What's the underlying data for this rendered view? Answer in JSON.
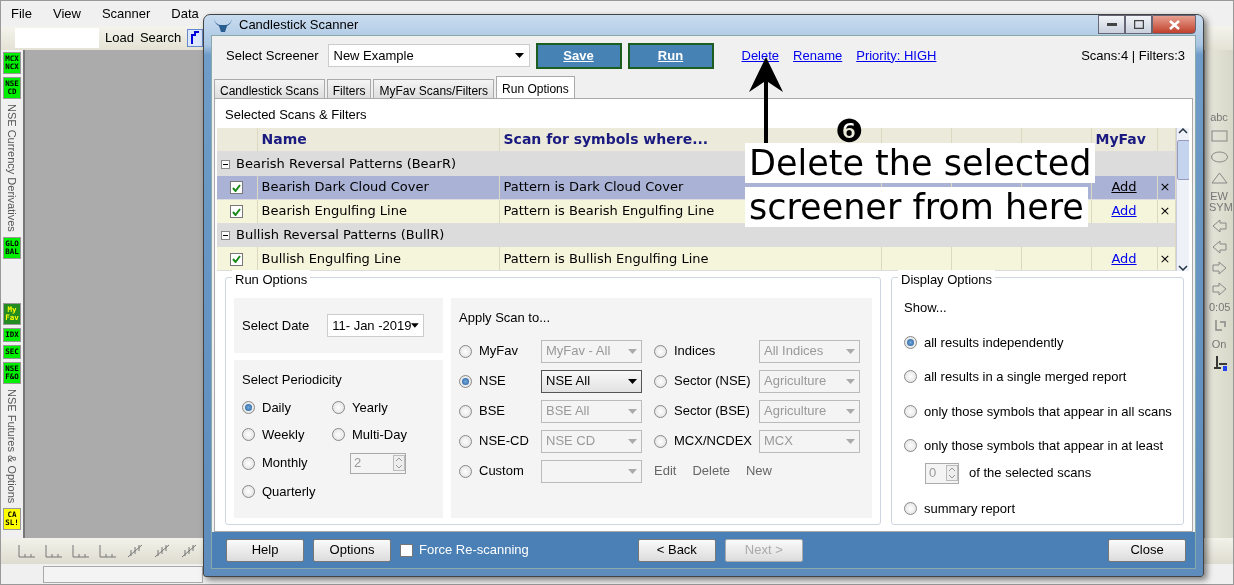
{
  "menu": [
    {
      "label": "File"
    },
    {
      "label": "View"
    },
    {
      "label": "Scanner"
    },
    {
      "label": "Data"
    }
  ],
  "toolbar": {
    "load": "Load",
    "search": "Search"
  },
  "left_strip": [
    {
      "kind": "badge",
      "lines": [
        "MCX",
        "NCX"
      ],
      "color": "#00ee00"
    },
    {
      "kind": "badge",
      "lines": [
        "NSE",
        "CD"
      ],
      "color": "#00ee00"
    },
    {
      "kind": "caption",
      "label": "NSE Currency Derivatives"
    },
    {
      "kind": "badge",
      "lines": [
        "GLO",
        "BAL"
      ],
      "color": "#00ee00"
    },
    {
      "kind": "gap"
    },
    {
      "kind": "badge",
      "lines": [
        "My",
        "Fav"
      ],
      "color": "#228b22"
    },
    {
      "kind": "badge",
      "lines": [
        "IDX"
      ],
      "color": "#00ee00"
    },
    {
      "kind": "badge",
      "lines": [
        "SEC"
      ],
      "color": "#00ee00"
    },
    {
      "kind": "badge",
      "lines": [
        "NSE",
        "F&O"
      ],
      "color": "#00ee00"
    },
    {
      "kind": "caption",
      "label": "NSE Futures & Options"
    },
    {
      "kind": "badge",
      "lines": [
        "CA",
        "SL!"
      ],
      "color": "#ffff00"
    }
  ],
  "drawing_tools": [
    {
      "kind": "text",
      "label": "abc"
    },
    {
      "kind": "rectangle"
    },
    {
      "kind": "ellipse"
    },
    {
      "kind": "triangle"
    },
    {
      "kind": "text",
      "label": "EW SYM"
    },
    {
      "kind": "arrow-left"
    },
    {
      "kind": "arrow-left"
    },
    {
      "kind": "arrow-right"
    },
    {
      "kind": "arrow-right"
    },
    {
      "kind": "text",
      "label": "0:05"
    },
    {
      "kind": "hook"
    },
    {
      "kind": "text",
      "label": "On"
    },
    {
      "kind": "cursor"
    }
  ],
  "dialog": {
    "title": "Candlestick Scanner",
    "screener": {
      "label": "Select Screener",
      "value": "New Example"
    },
    "buttons": [
      {
        "label": "Save"
      },
      {
        "label": "Run"
      }
    ],
    "links": [
      {
        "label": "Delete"
      },
      {
        "label": "Rename"
      },
      {
        "label": "Priority: HIGH"
      }
    ],
    "counts": "Scans:4 | Filters:3",
    "tabs": [
      {
        "label": "Candlestick Scans",
        "selected": false
      },
      {
        "label": "Filters",
        "selected": false
      },
      {
        "label": "MyFav Scans/Filters",
        "selected": false
      },
      {
        "label": "Run Options",
        "selected": true
      }
    ],
    "selected_heading": "Selected Scans & Filters",
    "table": {
      "columns": [
        "Name",
        "Scan for symbols where...",
        "MyFav"
      ],
      "rows": [
        {
          "kind": "group",
          "label": "Bearish Reversal Patterns (BearR)",
          "expanded": true
        },
        {
          "kind": "scan",
          "checked": true,
          "selected": true,
          "name": "Bearish Dark Cloud Cover",
          "condition": "Pattern is Dark Cloud Cover",
          "myfav": "Add",
          "remove": "×"
        },
        {
          "kind": "scan",
          "checked": true,
          "selected": false,
          "name": "Bearish Engulfing Line",
          "condition": "Pattern is Bearish Engulfing Line",
          "myfav": "Add",
          "remove": "×"
        },
        {
          "kind": "group",
          "label": "Bullish Reversal Patterns (BullR)",
          "expanded": true
        },
        {
          "kind": "scan",
          "checked": true,
          "selected": false,
          "name": "Bullish Engulfing Line",
          "condition": "Pattern is Bullish Engulfing Line",
          "myfav": "Add",
          "remove": "×"
        }
      ]
    },
    "annotation": {
      "number": "❻",
      "lines": [
        "Delete the selected",
        "screener from here"
      ]
    },
    "run_options": {
      "title": "Run Options",
      "date_label": "Select Date",
      "date_value": "11- Jan -2019",
      "periodicity_title": "Select Periodicity",
      "periodicity": [
        {
          "kind": "radio",
          "label": "Daily",
          "selected": true
        },
        {
          "kind": "radio",
          "label": "Yearly",
          "selected": false
        },
        {
          "kind": "radio",
          "label": "Weekly",
          "selected": false
        },
        {
          "kind": "radio",
          "label": "Multi-Day",
          "selected": false
        },
        {
          "kind": "radio",
          "label": "Monthly",
          "selected": false
        },
        {
          "kind": "spinner",
          "value": "2",
          "disabled": true
        },
        {
          "kind": "radio",
          "label": "Quarterly",
          "selected": false
        }
      ],
      "apply_title": "Apply Scan to...",
      "targets": [
        {
          "label": "MyFav",
          "selected": false,
          "dropdown": "MyFav - All",
          "disabled": true
        },
        {
          "label": "Indices",
          "selected": false,
          "dropdown": "All Indices",
          "disabled": true
        },
        {
          "label": "NSE",
          "selected": true,
          "dropdown": "NSE All",
          "disabled": false
        },
        {
          "label": "Sector (NSE)",
          "selected": false,
          "dropdown": "Agriculture",
          "disabled": true
        },
        {
          "label": "BSE",
          "selected": false,
          "dropdown": "BSE All",
          "disabled": true
        },
        {
          "label": "Sector (BSE)",
          "selected": false,
          "dropdown": "Agriculture",
          "disabled": true
        },
        {
          "label": "NSE-CD",
          "selected": false,
          "dropdown": "NSE CD",
          "disabled": true
        },
        {
          "label": "MCX/NCDEX",
          "selected": false,
          "dropdown": "MCX",
          "disabled": true
        },
        {
          "label": "Custom",
          "selected": false,
          "disabled": true
        }
      ],
      "custom_actions": [
        "Edit",
        "Delete",
        "New"
      ]
    },
    "display_options": {
      "title": "Display Options",
      "prompt": "Show...",
      "options": [
        {
          "label": "all results independently",
          "selected": true
        },
        {
          "label": "all results in a single merged report",
          "selected": false
        },
        {
          "label": "only those symbols that appear in all scans",
          "selected": false
        },
        {
          "label": "only those symbols that appear in at least",
          "selected": false,
          "threshold": {
            "value": "0",
            "suffix": "of the selected scans"
          }
        },
        {
          "label": "summary report",
          "selected": false
        }
      ]
    },
    "footer": {
      "help": "Help",
      "options": "Options",
      "force": {
        "label": "Force Re-scanning",
        "checked": false
      },
      "back": {
        "label": "< Back",
        "disabled": false
      },
      "next": {
        "label": "Next >",
        "disabled": true
      },
      "close": "Close"
    }
  }
}
